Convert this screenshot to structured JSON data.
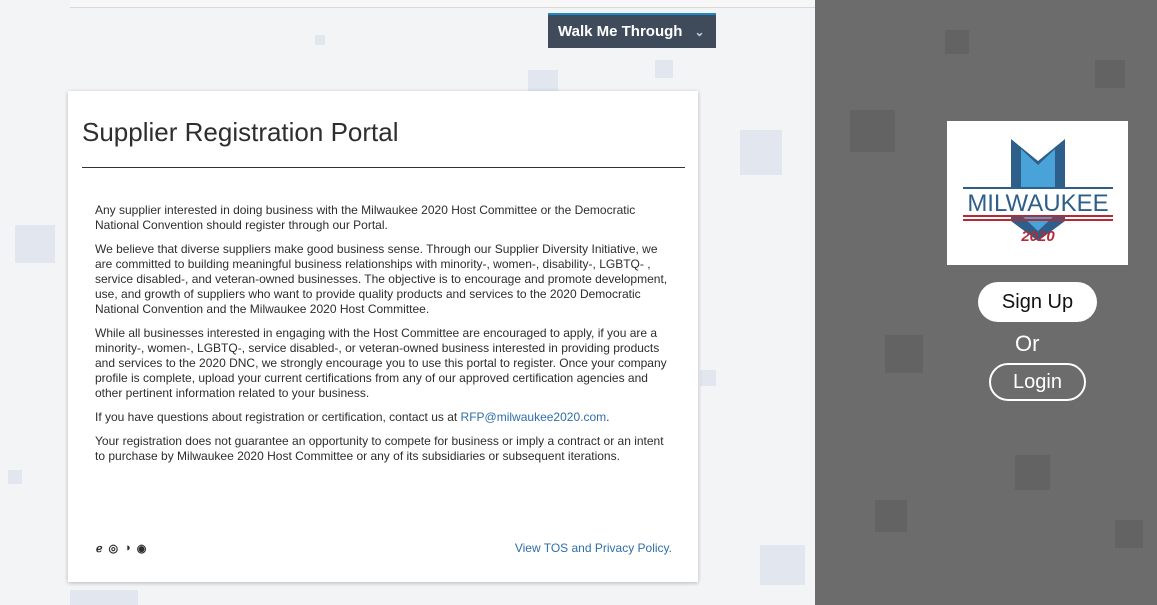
{
  "walk_menu": {
    "label": "Walk Me Through",
    "chevron": "chevron-down-icon"
  },
  "portal": {
    "title": "Supplier Registration Portal",
    "paragraphs": [
      "Any supplier interested in doing business with the Milwaukee 2020 Host Committee or the Democratic National Convention should register through our Portal.",
      "We believe that diverse suppliers make good business sense. Through our Supplier Diversity Initiative, we are committed to building meaningful business relationships with minority-, women-, disability-, LGBTQ- , service disabled-, and veteran-owned businesses. The objective is to encourage and promote development, use, and growth of suppliers who want to provide quality products and services to the 2020 Democratic National Convention and the Milwaukee 2020 Host Committee.",
      "While all businesses interested in engaging with the Host Committee are encouraged to apply, if you are a minority-, women-, LGBTQ-, service disabled-, or veteran-owned business interested in providing products and services to the 2020 DNC, we strongly encourage you to use this portal to register. Once your company profile is complete, upload your current certifications from any of our approved certification agencies and other pertinent information related to your business.",
      "Your registration does not guarantee an opportunity to compete for business or imply a contract or an intent to purchase by Milwaukee 2020 Host Committee or any of its subsidiaries or subsequent iterations."
    ],
    "contact_prefix": "If you have questions about registration or certification, contact us at ",
    "contact_email": "RFP@milwaukee2020.com",
    "contact_suffix": ".",
    "tos_link": "View TOS and Privacy Policy.",
    "browser_icons": [
      "edge-icon",
      "chrome-icon",
      "firefox-icon",
      "safari-icon"
    ]
  },
  "auth": {
    "logo_text": "MILWAUKEE",
    "logo_year": "2020",
    "signup_label": "Sign Up",
    "or_label": "Or",
    "login_label": "Login"
  },
  "colors": {
    "accent": "#1f88c8",
    "link": "#2f6ea8",
    "sidebar": "#6c6c6c",
    "logo_red": "#b62a34",
    "logo_blue": "#2d5f8a"
  }
}
